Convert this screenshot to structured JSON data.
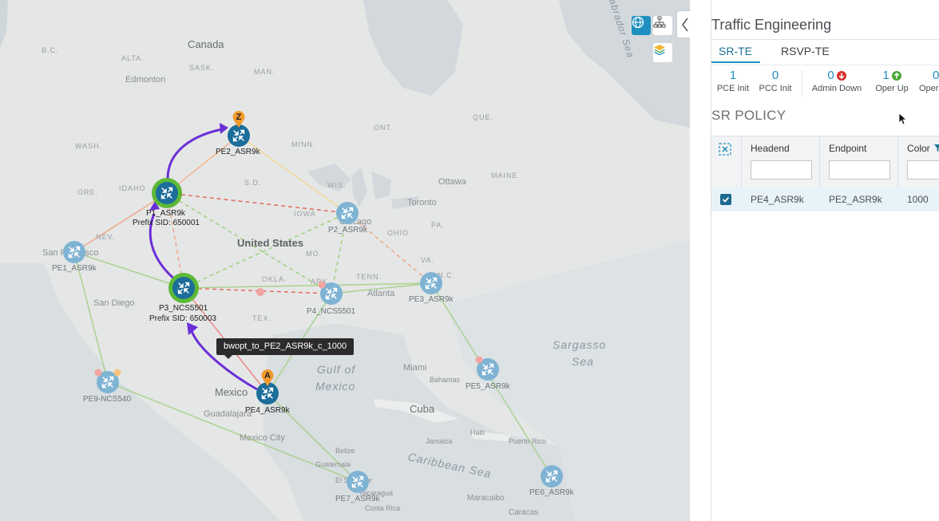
{
  "map": {
    "labels": {
      "canada": "Canada",
      "bc": "B.C.",
      "alta": "ALTA.",
      "sask": "SASK.",
      "edmonton": "Edmonton",
      "man": "MAN.",
      "ont": "ONT.",
      "que": "QUE.",
      "wash": "WASH.",
      "ore": "ORE.",
      "idaho": "IDAHO",
      "nev": "NEV.",
      "sd": "S.D.",
      "wis": "WIS.",
      "iowa": "IOWA",
      "maine": "MAINE",
      "ottawa": "Ottawa",
      "toronto": "Toronto",
      "minn": "MINN.",
      "united_states": "United States",
      "mo": "MO.",
      "okla": "OKLA.",
      "tenn": "TENN.",
      "ark": "ARK.",
      "va": "VA.",
      "pa": "PA.",
      "nc": "N.C.",
      "ohio": "OHIO",
      "tex": "TEX.",
      "atlanta": "Atlanta",
      "miami": "Miami",
      "bahamas": "Bahamas",
      "cuba": "Cuba",
      "haiti": "Haiti",
      "puerto_rico": "Puerto Rico",
      "jamaica": "Jamaica",
      "mexico": "Mexico",
      "guadalajara": "Guadalajara",
      "mexico_city": "Mexico City",
      "san_diego": "San Diego",
      "san_francisco": "San Francisco",
      "belize": "Belize",
      "guatemala": "Guatemala",
      "el_salvador": "El Salvador",
      "nicaragua": "Nicaragua",
      "costa_rica": "Costa Rica",
      "maracaibo": "Maracaibo",
      "caracas": "Caracas",
      "gulf_line1": "Gulf of",
      "gulf_line2": "Mexico",
      "sargasso_line1": "Sargasso",
      "sargasso_line2": "Sea",
      "caribbean": "Caribbean Sea",
      "labrador": "Labrador Sea",
      "chicago": "Chicago"
    },
    "nodes": {
      "pe2": "PE2_ASR9k",
      "p1": "P1_ASR9k",
      "p1_sid": "Prefix SID: 650001",
      "p2": "P2_ASR9k",
      "pe1": "PE1_ASR9k",
      "p3": "P3_NCS5501",
      "p3_sid": "Prefix SID: 650003",
      "p4": "P4_NCS5501",
      "pe3": "PE3_ASR9k",
      "pe4": "PE4_ASR9k",
      "pe5": "PE5_ASR9k",
      "pe6": "PE6_ASR9k",
      "pe7": "PE7_ASR9k",
      "pe9": "PE9-NCS540"
    },
    "markers": {
      "start": "A",
      "end": "Z"
    },
    "tooltip": "bwopt_to_PE2_ASR9k_c_1000",
    "controls": [
      "globe-icon",
      "topology-icon",
      "layers-icon"
    ]
  },
  "panel": {
    "title": "Traffic Engineering",
    "tabs": [
      {
        "label": "SR-TE",
        "active": true
      },
      {
        "label": "RSVP-TE",
        "active": false
      }
    ],
    "stats": [
      {
        "value": "1",
        "label": "PCE Init"
      },
      {
        "value": "0",
        "label": "PCC Init"
      },
      {
        "value": "0",
        "label": "Admin Down",
        "status": "down"
      },
      {
        "value": "1",
        "label": "Oper Up",
        "status": "up"
      },
      {
        "value": "0",
        "label": "Oper"
      }
    ],
    "section_title": "SR POLICY",
    "table": {
      "headers": [
        "Headend",
        "Endpoint",
        "Color"
      ],
      "rows": [
        {
          "selected": true,
          "headend": "PE4_ASR9k",
          "endpoint": "PE2_ASR9k",
          "color": "1000"
        }
      ]
    }
  },
  "colors": {
    "accent": "#1f8fbf",
    "path": "#6a2fd6",
    "node": "#1b6d9a",
    "node_highlight": "#5cb936",
    "marker": "#f39a2b",
    "down": "#d9302a",
    "up": "#4aa534"
  }
}
